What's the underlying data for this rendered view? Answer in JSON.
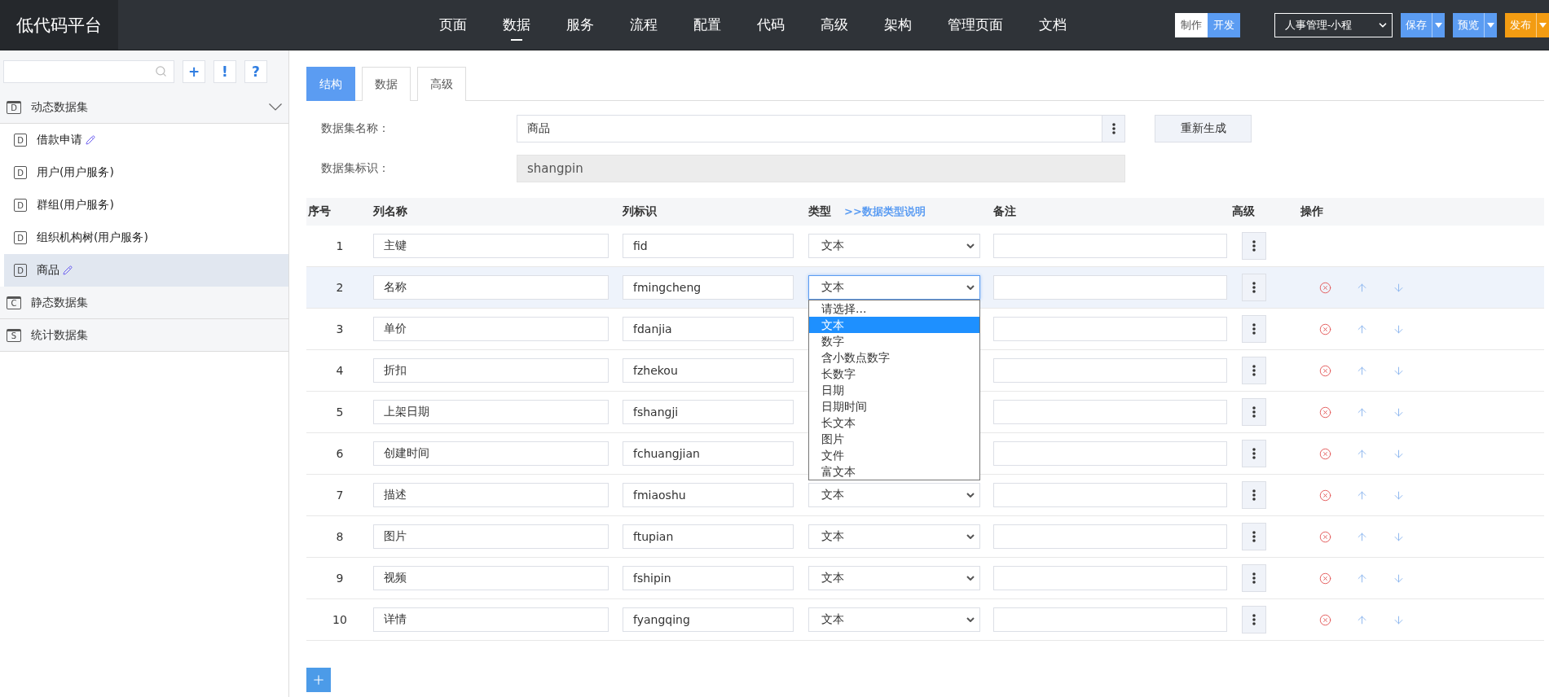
{
  "header": {
    "logo": "低代码平台",
    "nav": [
      {
        "label": "页面",
        "selected": false
      },
      {
        "label": "数据",
        "selected": true
      },
      {
        "label": "服务",
        "selected": false
      },
      {
        "label": "流程",
        "selected": false
      },
      {
        "label": "配置",
        "selected": false
      },
      {
        "label": "代码",
        "selected": false
      },
      {
        "label": "高级",
        "selected": false
      },
      {
        "label": "架构",
        "selected": false
      },
      {
        "label": "管理页面",
        "selected": false
      },
      {
        "label": "文档",
        "selected": false
      }
    ],
    "mode": [
      {
        "label": "制作",
        "selected": false
      },
      {
        "label": "开发",
        "selected": true
      }
    ],
    "app_select": "人事管理-小程",
    "actions": [
      {
        "label": "保存",
        "kind": "primary"
      },
      {
        "label": "预览",
        "kind": "primary"
      },
      {
        "label": "发布",
        "kind": "warning"
      }
    ]
  },
  "sidebar": {
    "tools": [
      "+",
      "!",
      "?"
    ],
    "groups": [
      {
        "label": "动态数据集",
        "badge": "D",
        "expanded": true,
        "children": [
          {
            "label": "借款申请",
            "badge": "D",
            "editable": true,
            "selected": false
          },
          {
            "label": "用户(用户服务)",
            "badge": "D",
            "editable": false,
            "selected": false
          },
          {
            "label": "群组(用户服务)",
            "badge": "D",
            "editable": false,
            "selected": false
          },
          {
            "label": "组织机构树(用户服务)",
            "badge": "D",
            "editable": false,
            "selected": false
          },
          {
            "label": "商品",
            "badge": "D",
            "editable": true,
            "selected": true
          }
        ]
      },
      {
        "label": "静态数据集",
        "badge": "C",
        "expanded": false
      },
      {
        "label": "统计数据集",
        "badge": "S",
        "expanded": false
      }
    ]
  },
  "tabs": [
    {
      "label": "结构",
      "selected": true
    },
    {
      "label": "数据",
      "selected": false
    },
    {
      "label": "高级",
      "selected": false
    }
  ],
  "form": {
    "name_label": "数据集名称：",
    "name_value": "商品",
    "regenerate": "重新生成",
    "key_label": "数据集标识：",
    "key_value": "shangpin"
  },
  "table": {
    "columns": [
      "序号",
      "列名称",
      "列标识",
      "类型",
      "备注",
      "高级",
      "操作"
    ],
    "type_help": ">>数据类型说明",
    "rows": [
      {
        "index": "1",
        "name": "主键",
        "key": "fid",
        "type": "文本",
        "selected": false,
        "actions": false
      },
      {
        "index": "2",
        "name": "名称",
        "key": "fmingcheng",
        "type": "文本",
        "selected": true,
        "actions": true,
        "type_options": [
          {
            "label": "请选择...",
            "selected": false
          },
          {
            "label": "文本",
            "selected": true
          },
          {
            "label": "数字",
            "selected": false
          },
          {
            "label": "含小数点数字",
            "selected": false
          },
          {
            "label": "长数字",
            "selected": false
          },
          {
            "label": "日期",
            "selected": false
          },
          {
            "label": "日期时间",
            "selected": false
          },
          {
            "label": "长文本",
            "selected": false
          },
          {
            "label": "图片",
            "selected": false
          },
          {
            "label": "文件",
            "selected": false
          },
          {
            "label": "富文本",
            "selected": false
          }
        ]
      },
      {
        "index": "3",
        "name": "单价",
        "key": "fdanjia",
        "selected": false,
        "actions": true
      },
      {
        "index": "4",
        "name": "折扣",
        "key": "fzhekou",
        "selected": false,
        "actions": true
      },
      {
        "index": "5",
        "name": "上架日期",
        "key": "fshangji",
        "selected": false,
        "actions": true
      },
      {
        "index": "6",
        "name": "创建时间",
        "key": "fchuangjian",
        "selected": false,
        "actions": true
      },
      {
        "index": "7",
        "name": "描述",
        "key": "fmiaoshu",
        "type": "文本",
        "selected": false,
        "actions": true
      },
      {
        "index": "8",
        "name": "图片",
        "key": "ftupian",
        "type": "文本",
        "selected": false,
        "actions": true
      },
      {
        "index": "9",
        "name": "视频",
        "key": "fshipin",
        "type": "文本",
        "selected": false,
        "actions": true
      },
      {
        "index": "10",
        "name": "详情",
        "key": "fyangqing",
        "type": "文本",
        "selected": false,
        "actions": true
      }
    ]
  }
}
